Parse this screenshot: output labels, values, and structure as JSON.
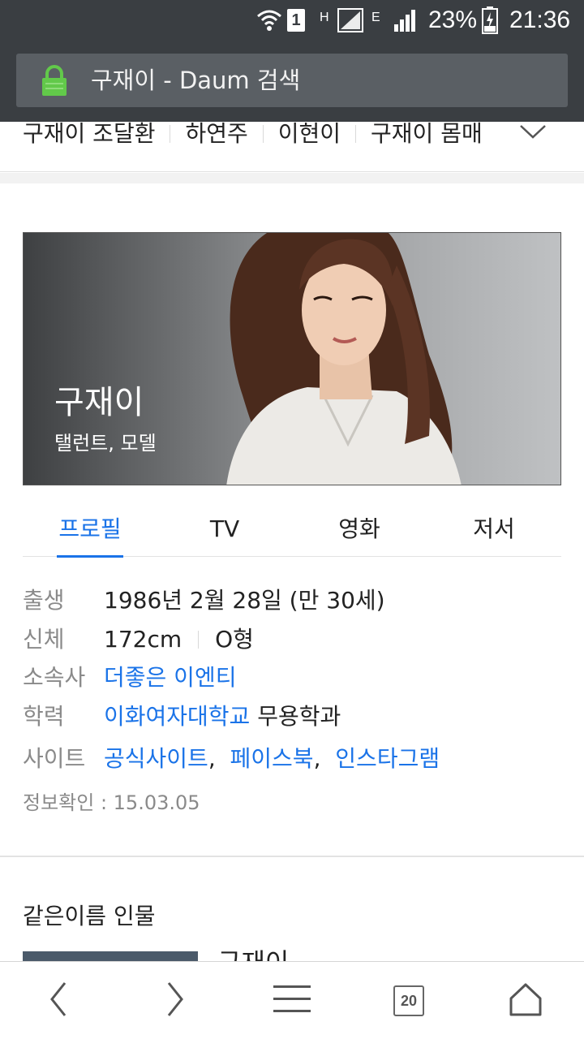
{
  "status_bar": {
    "sim_label": "1",
    "net_h": "H",
    "net_e": "E",
    "battery": "23%",
    "time": "21:36"
  },
  "browser": {
    "url_title": "구재이 - Daum 검색",
    "tab_count": "20"
  },
  "related_searches": [
    "구재이 조달환",
    "하연주",
    "이현이",
    "구재이 몸매"
  ],
  "profile": {
    "name": "구재이",
    "role": "탤런트, 모델"
  },
  "tabs": [
    {
      "label": "프로필",
      "active": true
    },
    {
      "label": "TV",
      "active": false
    },
    {
      "label": "영화",
      "active": false
    },
    {
      "label": "저서",
      "active": false
    }
  ],
  "info": {
    "birth_label": "출생",
    "birth_value": "1986년 2월 28일 (만 30세)",
    "body_label": "신체",
    "height": "172cm",
    "blood": "O형",
    "agency_label": "소속사",
    "agency_value": "더좋은 이엔티",
    "edu_label": "학력",
    "edu_school": "이화여자대학교",
    "edu_major": " 무용학과",
    "site_label": "사이트",
    "site_links": [
      "공식사이트",
      "페이스북",
      "인스타그램"
    ],
    "site_comma": ",",
    "checked": "정보확인 : 15.03.05"
  },
  "same_name": {
    "heading": "같은이름 인물",
    "first_name": "구재이"
  },
  "colors": {
    "accent": "#1a73e8",
    "chrome": "#3a3e42",
    "lock": "#62c94a"
  },
  "icons": [
    "wifi-icon",
    "signal-icon",
    "battery-icon",
    "lock-icon",
    "chevron-down-icon",
    "back-icon",
    "forward-icon",
    "menu-icon",
    "tabs-icon",
    "home-icon"
  ]
}
